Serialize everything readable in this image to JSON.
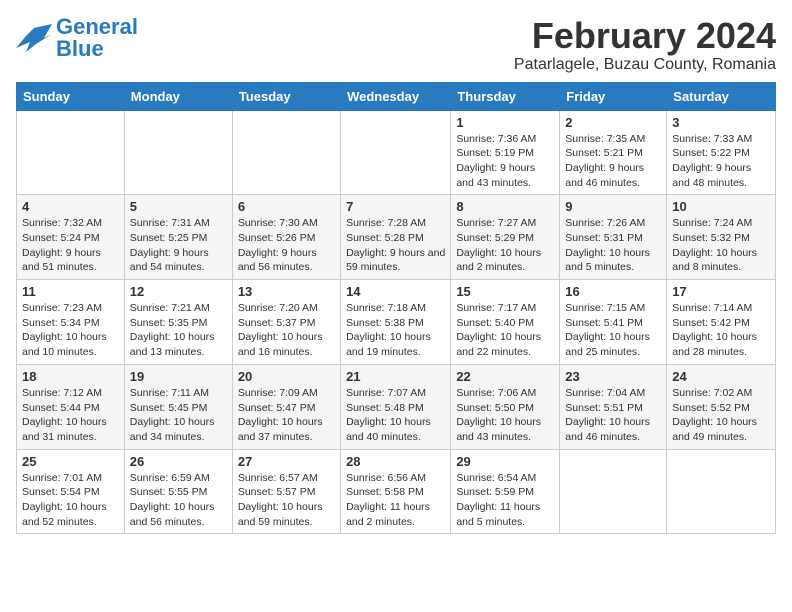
{
  "header": {
    "logo": "General Blue",
    "month_title": "February 2024",
    "location": "Patarlagele, Buzau County, Romania"
  },
  "days_of_week": [
    "Sunday",
    "Monday",
    "Tuesday",
    "Wednesday",
    "Thursday",
    "Friday",
    "Saturday"
  ],
  "weeks": [
    [
      {
        "num": "",
        "sunrise": "",
        "sunset": "",
        "daylight": ""
      },
      {
        "num": "",
        "sunrise": "",
        "sunset": "",
        "daylight": ""
      },
      {
        "num": "",
        "sunrise": "",
        "sunset": "",
        "daylight": ""
      },
      {
        "num": "",
        "sunrise": "",
        "sunset": "",
        "daylight": ""
      },
      {
        "num": "1",
        "sunrise": "7:36 AM",
        "sunset": "5:19 PM",
        "daylight": "9 hours and 43 minutes."
      },
      {
        "num": "2",
        "sunrise": "7:35 AM",
        "sunset": "5:21 PM",
        "daylight": "9 hours and 46 minutes."
      },
      {
        "num": "3",
        "sunrise": "7:33 AM",
        "sunset": "5:22 PM",
        "daylight": "9 hours and 48 minutes."
      }
    ],
    [
      {
        "num": "4",
        "sunrise": "7:32 AM",
        "sunset": "5:24 PM",
        "daylight": "9 hours and 51 minutes."
      },
      {
        "num": "5",
        "sunrise": "7:31 AM",
        "sunset": "5:25 PM",
        "daylight": "9 hours and 54 minutes."
      },
      {
        "num": "6",
        "sunrise": "7:30 AM",
        "sunset": "5:26 PM",
        "daylight": "9 hours and 56 minutes."
      },
      {
        "num": "7",
        "sunrise": "7:28 AM",
        "sunset": "5:28 PM",
        "daylight": "9 hours and 59 minutes."
      },
      {
        "num": "8",
        "sunrise": "7:27 AM",
        "sunset": "5:29 PM",
        "daylight": "10 hours and 2 minutes."
      },
      {
        "num": "9",
        "sunrise": "7:26 AM",
        "sunset": "5:31 PM",
        "daylight": "10 hours and 5 minutes."
      },
      {
        "num": "10",
        "sunrise": "7:24 AM",
        "sunset": "5:32 PM",
        "daylight": "10 hours and 8 minutes."
      }
    ],
    [
      {
        "num": "11",
        "sunrise": "7:23 AM",
        "sunset": "5:34 PM",
        "daylight": "10 hours and 10 minutes."
      },
      {
        "num": "12",
        "sunrise": "7:21 AM",
        "sunset": "5:35 PM",
        "daylight": "10 hours and 13 minutes."
      },
      {
        "num": "13",
        "sunrise": "7:20 AM",
        "sunset": "5:37 PM",
        "daylight": "10 hours and 16 minutes."
      },
      {
        "num": "14",
        "sunrise": "7:18 AM",
        "sunset": "5:38 PM",
        "daylight": "10 hours and 19 minutes."
      },
      {
        "num": "15",
        "sunrise": "7:17 AM",
        "sunset": "5:40 PM",
        "daylight": "10 hours and 22 minutes."
      },
      {
        "num": "16",
        "sunrise": "7:15 AM",
        "sunset": "5:41 PM",
        "daylight": "10 hours and 25 minutes."
      },
      {
        "num": "17",
        "sunrise": "7:14 AM",
        "sunset": "5:42 PM",
        "daylight": "10 hours and 28 minutes."
      }
    ],
    [
      {
        "num": "18",
        "sunrise": "7:12 AM",
        "sunset": "5:44 PM",
        "daylight": "10 hours and 31 minutes."
      },
      {
        "num": "19",
        "sunrise": "7:11 AM",
        "sunset": "5:45 PM",
        "daylight": "10 hours and 34 minutes."
      },
      {
        "num": "20",
        "sunrise": "7:09 AM",
        "sunset": "5:47 PM",
        "daylight": "10 hours and 37 minutes."
      },
      {
        "num": "21",
        "sunrise": "7:07 AM",
        "sunset": "5:48 PM",
        "daylight": "10 hours and 40 minutes."
      },
      {
        "num": "22",
        "sunrise": "7:06 AM",
        "sunset": "5:50 PM",
        "daylight": "10 hours and 43 minutes."
      },
      {
        "num": "23",
        "sunrise": "7:04 AM",
        "sunset": "5:51 PM",
        "daylight": "10 hours and 46 minutes."
      },
      {
        "num": "24",
        "sunrise": "7:02 AM",
        "sunset": "5:52 PM",
        "daylight": "10 hours and 49 minutes."
      }
    ],
    [
      {
        "num": "25",
        "sunrise": "7:01 AM",
        "sunset": "5:54 PM",
        "daylight": "10 hours and 52 minutes."
      },
      {
        "num": "26",
        "sunrise": "6:59 AM",
        "sunset": "5:55 PM",
        "daylight": "10 hours and 56 minutes."
      },
      {
        "num": "27",
        "sunrise": "6:57 AM",
        "sunset": "5:57 PM",
        "daylight": "10 hours and 59 minutes."
      },
      {
        "num": "28",
        "sunrise": "6:56 AM",
        "sunset": "5:58 PM",
        "daylight": "11 hours and 2 minutes."
      },
      {
        "num": "29",
        "sunrise": "6:54 AM",
        "sunset": "5:59 PM",
        "daylight": "11 hours and 5 minutes."
      },
      {
        "num": "",
        "sunrise": "",
        "sunset": "",
        "daylight": ""
      },
      {
        "num": "",
        "sunrise": "",
        "sunset": "",
        "daylight": ""
      }
    ]
  ]
}
